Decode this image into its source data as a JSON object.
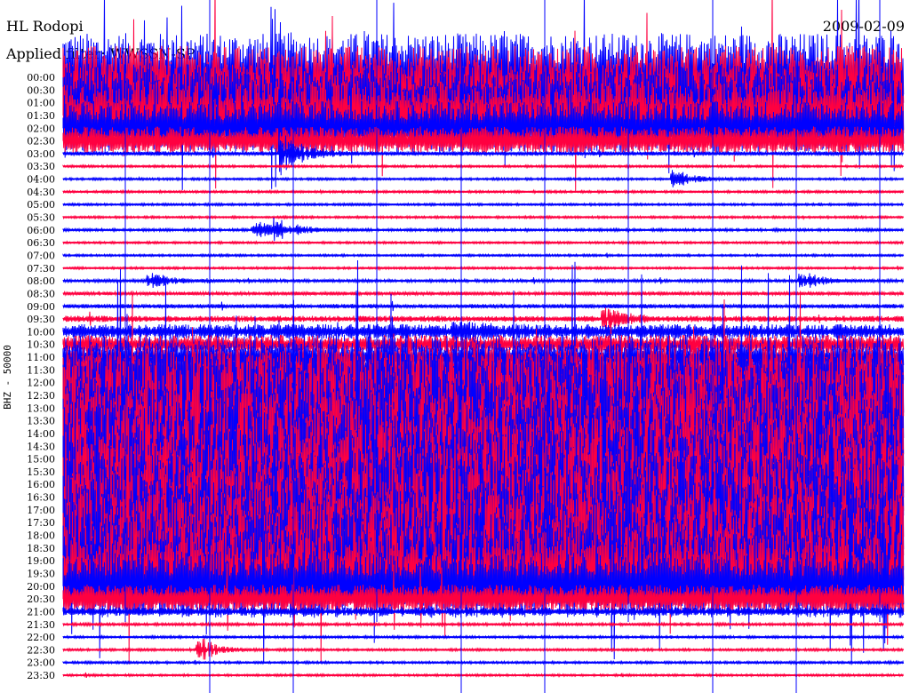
{
  "header": {
    "station": "HL Rodopi",
    "filter": "Applied filter: WWSSN-SP",
    "date": "2009-02-09"
  },
  "chart_data": {
    "type": "line",
    "title": "HL Rodopi 2009-02-09",
    "ylabel": "BHZ - 50000",
    "xlabel": "",
    "x_unit": "minutes within row",
    "xlim": [
      0,
      30
    ],
    "colors": {
      "even": "#0000ff",
      "odd": "#ff0040"
    },
    "rows": [
      "00:00",
      "00:30",
      "01:00",
      "01:30",
      "02:00",
      "02:30",
      "03:00",
      "03:30",
      "04:00",
      "04:30",
      "05:00",
      "05:30",
      "06:00",
      "06:30",
      "07:00",
      "07:30",
      "08:00",
      "08:30",
      "09:00",
      "09:30",
      "10:00",
      "10:30",
      "11:00",
      "11:30",
      "12:00",
      "12:30",
      "13:00",
      "13:30",
      "14:00",
      "14:30",
      "15:00",
      "15:30",
      "16:00",
      "16:30",
      "17:00",
      "17:30",
      "18:00",
      "18:30",
      "19:00",
      "19:30",
      "20:00",
      "20:30",
      "21:00",
      "21:30",
      "22:00",
      "22:30",
      "23:00",
      "23:30"
    ],
    "noise_level": [
      0.9,
      0.9,
      0.85,
      0.8,
      0.7,
      0.5,
      0.15,
      0.05,
      0.05,
      0.05,
      0.05,
      0.05,
      0.08,
      0.04,
      0.04,
      0.04,
      0.1,
      0.12,
      0.15,
      0.2,
      0.35,
      0.4,
      0.5,
      0.6,
      0.95,
      1,
      1,
      1,
      1,
      1,
      1,
      1,
      1,
      1,
      1,
      1,
      1,
      1,
      0.95,
      0.9,
      0.8,
      0.5,
      0.25,
      0.08,
      0.06,
      0.06,
      0.06,
      0.04
    ],
    "events": [
      {
        "row": 6,
        "minute": 8,
        "amp": 1.5
      },
      {
        "row": 8,
        "minute": 22,
        "amp": 0.7
      },
      {
        "row": 12,
        "minute": 7,
        "amp": 0.6
      },
      {
        "row": 12,
        "minute": 7.8,
        "amp": 0.8
      },
      {
        "row": 16,
        "minute": 3.3,
        "amp": 0.6
      },
      {
        "row": 16,
        "minute": 26.5,
        "amp": 0.7
      },
      {
        "row": 19,
        "minute": 19.5,
        "amp": 0.8
      },
      {
        "row": 20,
        "minute": 14.2,
        "amp": 0.6
      },
      {
        "row": 45,
        "minute": 5,
        "amp": 0.9
      }
    ]
  }
}
